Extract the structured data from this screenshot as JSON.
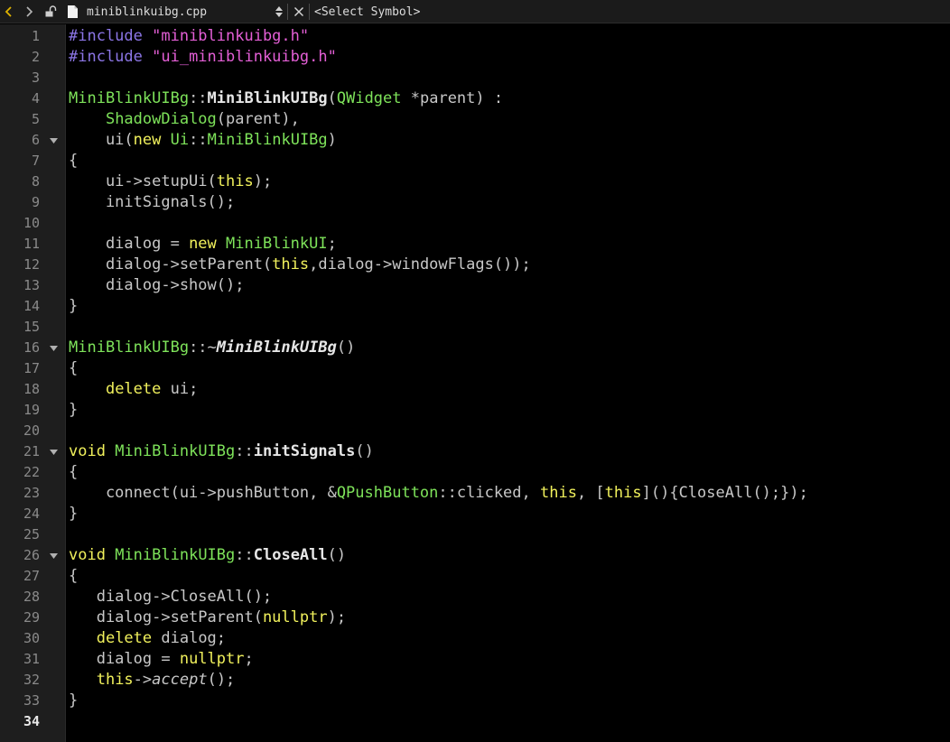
{
  "toolbar": {
    "back_icon": "chevron-left-icon",
    "forward_icon": "chevron-right-icon",
    "filename": "miniblinkuibg.cpp",
    "symbol_selector": "<Select Symbol>",
    "accent_color": "#e0b400"
  },
  "gutter": {
    "line_numbers": [
      "1",
      "2",
      "3",
      "4",
      "5",
      "6",
      "7",
      "8",
      "9",
      "10",
      "11",
      "12",
      "13",
      "14",
      "15",
      "16",
      "17",
      "18",
      "19",
      "20",
      "21",
      "22",
      "23",
      "24",
      "25",
      "26",
      "27",
      "28",
      "29",
      "30",
      "31",
      "32",
      "33",
      "34"
    ],
    "current_line": "34"
  },
  "code": {
    "lines": [
      [
        {
          "t": "#include ",
          "c": "pre"
        },
        {
          "t": "\"miniblinkuibg.h\"",
          "c": "str"
        }
      ],
      [
        {
          "t": "#include ",
          "c": "pre"
        },
        {
          "t": "\"ui_miniblinkuibg.h\"",
          "c": "str"
        }
      ],
      [],
      [
        {
          "t": "MiniBlinkUIBg",
          "c": "type"
        },
        {
          "t": "::",
          "c": "op"
        },
        {
          "t": "MiniBlinkUIBg",
          "c": "bold"
        },
        {
          "t": "(",
          "c": "op"
        },
        {
          "t": "QWidget",
          "c": "type"
        },
        {
          "t": " *parent) :",
          "c": "op"
        }
      ],
      [
        {
          "t": "    ",
          "c": "op"
        },
        {
          "t": "ShadowDialog",
          "c": "type"
        },
        {
          "t": "(parent),",
          "c": "op"
        }
      ],
      [
        {
          "t": "    ui(",
          "c": "op"
        },
        {
          "t": "new",
          "c": "kw"
        },
        {
          "t": " ",
          "c": "op"
        },
        {
          "t": "Ui",
          "c": "type"
        },
        {
          "t": "::",
          "c": "op"
        },
        {
          "t": "MiniBlinkUIBg",
          "c": "type"
        },
        {
          "t": ")",
          "c": "op"
        }
      ],
      [
        {
          "t": "{",
          "c": "op"
        }
      ],
      [
        {
          "t": "    ui->setupUi(",
          "c": "op"
        },
        {
          "t": "this",
          "c": "kw"
        },
        {
          "t": ");",
          "c": "op"
        }
      ],
      [
        {
          "t": "    initSignals();",
          "c": "op"
        }
      ],
      [],
      [
        {
          "t": "    dialog = ",
          "c": "op"
        },
        {
          "t": "new",
          "c": "kw"
        },
        {
          "t": " ",
          "c": "op"
        },
        {
          "t": "MiniBlinkUI",
          "c": "type"
        },
        {
          "t": ";",
          "c": "op"
        }
      ],
      [
        {
          "t": "    dialog->setParent(",
          "c": "op"
        },
        {
          "t": "this",
          "c": "kw"
        },
        {
          "t": ",dialog->windowFlags());",
          "c": "op"
        }
      ],
      [
        {
          "t": "    dialog->show();",
          "c": "op"
        }
      ],
      [
        {
          "t": "}",
          "c": "op"
        }
      ],
      [],
      [
        {
          "t": "MiniBlinkUIBg",
          "c": "type"
        },
        {
          "t": "::~",
          "c": "op"
        },
        {
          "t": "MiniBlinkUIBg",
          "c": "bold-ital"
        },
        {
          "t": "()",
          "c": "op"
        }
      ],
      [
        {
          "t": "{",
          "c": "op"
        }
      ],
      [
        {
          "t": "    ",
          "c": "op"
        },
        {
          "t": "delete",
          "c": "kw"
        },
        {
          "t": " ui;",
          "c": "op"
        }
      ],
      [
        {
          "t": "}",
          "c": "op"
        }
      ],
      [],
      [
        {
          "t": "void",
          "c": "kw"
        },
        {
          "t": " ",
          "c": "op"
        },
        {
          "t": "MiniBlinkUIBg",
          "c": "type"
        },
        {
          "t": "::",
          "c": "op"
        },
        {
          "t": "initSignals",
          "c": "bold"
        },
        {
          "t": "()",
          "c": "op"
        }
      ],
      [
        {
          "t": "{",
          "c": "op"
        }
      ],
      [
        {
          "t": "    connect(ui->pushButton, &",
          "c": "op"
        },
        {
          "t": "QPushButton",
          "c": "type"
        },
        {
          "t": "::clicked, ",
          "c": "op"
        },
        {
          "t": "this",
          "c": "kw"
        },
        {
          "t": ", [",
          "c": "op"
        },
        {
          "t": "this",
          "c": "kw"
        },
        {
          "t": "](){CloseAll();});",
          "c": "op"
        }
      ],
      [
        {
          "t": "}",
          "c": "op"
        }
      ],
      [],
      [
        {
          "t": "void",
          "c": "kw"
        },
        {
          "t": " ",
          "c": "op"
        },
        {
          "t": "MiniBlinkUIBg",
          "c": "type"
        },
        {
          "t": "::",
          "c": "op"
        },
        {
          "t": "CloseAll",
          "c": "bold"
        },
        {
          "t": "()",
          "c": "op"
        }
      ],
      [
        {
          "t": "{",
          "c": "op"
        }
      ],
      [
        {
          "t": "   dialog->CloseAll();",
          "c": "op"
        }
      ],
      [
        {
          "t": "   dialog->setParent(",
          "c": "op"
        },
        {
          "t": "nullptr",
          "c": "kw"
        },
        {
          "t": ");",
          "c": "op"
        }
      ],
      [
        {
          "t": "   ",
          "c": "op"
        },
        {
          "t": "delete",
          "c": "kw"
        },
        {
          "t": " dialog;",
          "c": "op"
        }
      ],
      [
        {
          "t": "   dialog = ",
          "c": "op"
        },
        {
          "t": "nullptr",
          "c": "kw"
        },
        {
          "t": ";",
          "c": "op"
        }
      ],
      [
        {
          "t": "   ",
          "c": "op"
        },
        {
          "t": "this",
          "c": "kw"
        },
        {
          "t": "->",
          "c": "op"
        },
        {
          "t": "accept",
          "c": "ital"
        },
        {
          "t": "();",
          "c": "op"
        }
      ],
      [
        {
          "t": "}",
          "c": "op"
        }
      ],
      []
    ],
    "fold_marker_lines": [
      "6",
      "16",
      "21",
      "26"
    ]
  },
  "colors": {
    "background": "#000000",
    "gutter": "#1e1e1e",
    "preprocessor": "#8c76e6",
    "string": "#e45fd6",
    "type": "#7ee35a",
    "keyword": "#f1f15c",
    "text": "#c8c8c8"
  }
}
